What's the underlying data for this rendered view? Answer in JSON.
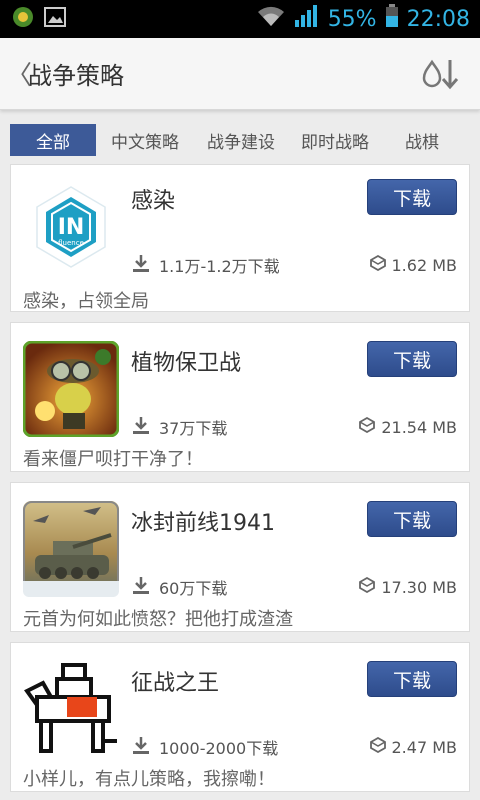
{
  "status_bar": {
    "battery_percent": "55%",
    "time": "22:08"
  },
  "header": {
    "back_glyph": "〈",
    "title": "战争策略"
  },
  "tabs": [
    {
      "label": "全部",
      "active": true
    },
    {
      "label": "中文策略",
      "active": false
    },
    {
      "label": "战争建设",
      "active": false
    },
    {
      "label": "即时战略",
      "active": false
    },
    {
      "label": "战棋",
      "active": false
    }
  ],
  "apps": [
    {
      "name": "感染",
      "download_label": "下载",
      "downloads": "1.1万-1.2万下载",
      "size": "1.62 MB",
      "description": "感染，占领全局",
      "icon_text": "IN",
      "icon_subtext": "fluence"
    },
    {
      "name": "植物保卫战",
      "download_label": "下载",
      "downloads": "37万下载",
      "size": "21.54 MB",
      "description": "看来僵尸呗打干净了！"
    },
    {
      "name": "冰封前线1941",
      "download_label": "下载",
      "downloads": "60万下载",
      "size": "17.30 MB",
      "description": "元首为何如此愤怒？把他打成渣渣"
    },
    {
      "name": "征战之王",
      "download_label": "下载",
      "downloads": "1000-2000下载",
      "size": "2.47 MB",
      "description": "小样儿，有点儿策略，我擦嘞！"
    }
  ],
  "colors": {
    "accent": "#3d5a98",
    "status_blue": "#33b5e5"
  }
}
